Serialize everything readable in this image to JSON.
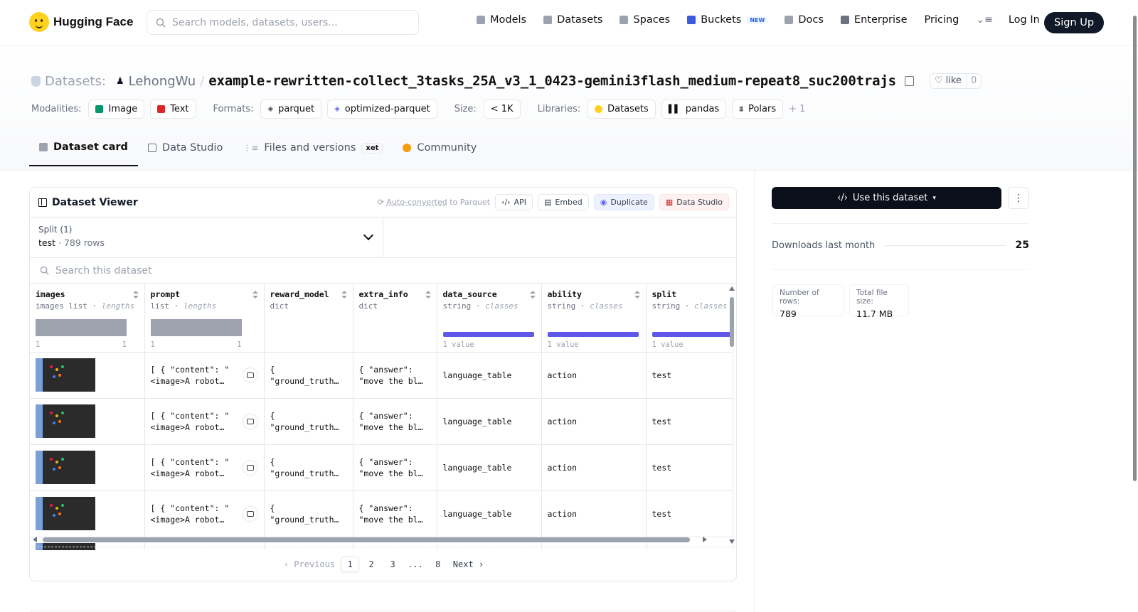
{
  "header": {
    "brand": "Hugging Face",
    "search_placeholder": "Search models, datasets, users...",
    "nav": [
      {
        "label": "Models",
        "icon": "cube-icon"
      },
      {
        "label": "Datasets",
        "icon": "database-icon"
      },
      {
        "label": "Spaces",
        "icon": "grid-icon"
      },
      {
        "label": "Buckets",
        "icon": "bucket-icon",
        "badge": "NEW"
      },
      {
        "label": "Docs",
        "icon": "book-icon"
      },
      {
        "label": "Enterprise",
        "icon": "enterprise-icon"
      },
      {
        "label": "Pricing"
      }
    ],
    "login": "Log In",
    "signup": "Sign Up"
  },
  "repo": {
    "prefix": "Datasets:",
    "owner": "LehongWu",
    "name": "example-rewritten-collect_3tasks_25A_v3_1_0423-gemini3flash_medium-repeat8_suc200trajs",
    "like_label": "like",
    "like_count": "0"
  },
  "meta": {
    "modalities_label": "Modalities:",
    "modalities": [
      "Image",
      "Text"
    ],
    "formats_label": "Formats:",
    "formats": [
      "parquet",
      "optimized-parquet"
    ],
    "size_label": "Size:",
    "size": "< 1K",
    "libraries_label": "Libraries:",
    "libraries": [
      "Datasets",
      "pandas",
      "Polars"
    ],
    "more": "+ 1"
  },
  "tabs": [
    {
      "label": "Dataset card",
      "active": true
    },
    {
      "label": "Data Studio"
    },
    {
      "label": "Files and versions",
      "badge": "xet"
    },
    {
      "label": "Community"
    }
  ],
  "viewer": {
    "title": "Dataset Viewer",
    "auto_converted": "Auto-converted",
    "auto_suffix": "to Parquet",
    "actions": [
      "API",
      "Embed",
      "Duplicate",
      "Data Studio"
    ],
    "split_label": "Split (1)",
    "split_value": "test",
    "split_rows": "789 rows",
    "search_placeholder": "Search this dataset",
    "columns": [
      {
        "name": "images",
        "type": "images list",
        "stat": "lengths",
        "min": "1",
        "max": "1"
      },
      {
        "name": "prompt",
        "type": "list",
        "stat": "lengths",
        "min": "1",
        "max": "1"
      },
      {
        "name": "reward_model",
        "type": "dict",
        "stat": ""
      },
      {
        "name": "extra_info",
        "type": "dict",
        "stat": ""
      },
      {
        "name": "data_source",
        "type": "string",
        "stat": "classes",
        "classes_label": "1 value"
      },
      {
        "name": "ability",
        "type": "string",
        "stat": "classes",
        "classes_label": "1 value"
      },
      {
        "name": "split",
        "type": "string",
        "stat": "classes",
        "classes_label": "1 value"
      }
    ],
    "rows": [
      {
        "prompt": "[ { \"content\": \"\n<image>A robot…",
        "reward_model": "{\n\"ground_truth…",
        "extra_info": "{ \"answer\":\n\"move the bl…",
        "data_source": "language_table",
        "ability": "action",
        "split": "test"
      },
      {
        "prompt": "[ { \"content\": \"\n<image>A robot…",
        "reward_model": "{\n\"ground_truth…",
        "extra_info": "{ \"answer\":\n\"move the bl…",
        "data_source": "language_table",
        "ability": "action",
        "split": "test"
      },
      {
        "prompt": "[ { \"content\": \"\n<image>A robot…",
        "reward_model": "{\n\"ground_truth…",
        "extra_info": "{ \"answer\":\n\"move the bl…",
        "data_source": "language_table",
        "ability": "action",
        "split": "test"
      },
      {
        "prompt": "[ { \"content\": \"\n<image>A robot…",
        "reward_model": "{\n\"ground_truth…",
        "extra_info": "{ \"answer\":\n\"move the bl…",
        "data_source": "language_table",
        "ability": "action",
        "split": "test"
      }
    ],
    "pager": {
      "prev": "Previous",
      "pages": [
        "1",
        "2",
        "3",
        "...",
        "8"
      ],
      "current": "1",
      "next": "Next"
    }
  },
  "sidebar": {
    "use_button": "Use this dataset",
    "downloads_label": "Downloads last month",
    "downloads_value": "25",
    "rows_label": "Number of rows:",
    "rows_value": "789",
    "size_label": "Total file size:",
    "size_value": "11.7 MB"
  },
  "colors": {
    "accent_indigo": "#4f46e5",
    "signup_bg": "#111827",
    "use_btn_bg": "#0b0f19"
  }
}
